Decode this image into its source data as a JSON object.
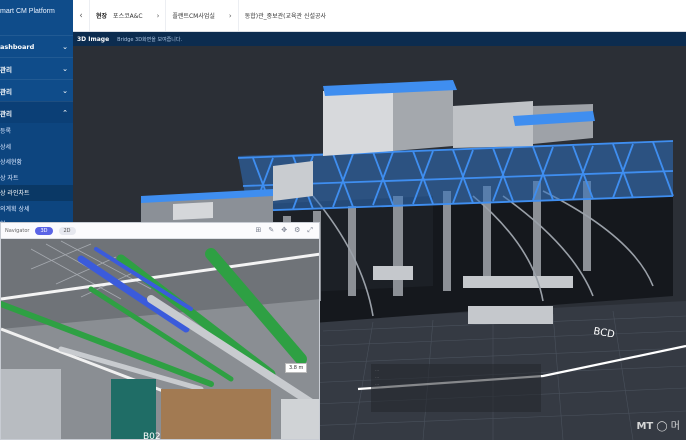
{
  "brand": "mart CM Platform",
  "sidebar": {
    "items": [
      {
        "label": "ashboard",
        "expanded": false
      },
      {
        "label": "관리",
        "expanded": false
      },
      {
        "label": "관리",
        "expanded": false
      },
      {
        "label": "관리",
        "expanded": true
      }
    ],
    "subitems": [
      "등록",
      "상세",
      "상세현황",
      "상 자트",
      "상 라인차트",
      "의계획 상세",
      "현"
    ],
    "active_subitem_index": 4
  },
  "breadcrumb": {
    "label": "현장",
    "items": [
      "포스코A&C",
      "플랜트CM사업실",
      "동합)관_중보관(교육관 신설공사"
    ]
  },
  "strip": {
    "title": "3D Image",
    "subtitle": "Bridge 3D화면을 보여줍니다."
  },
  "inset": {
    "tool_title": "Navigator",
    "mode_pills": [
      "3D",
      "2D"
    ],
    "label_tag": "3.8 m"
  },
  "viewport": {
    "info_lines": [
      "...",
      "...",
      "..."
    ]
  },
  "watermark": {
    "prefix": "MT",
    "suffix": "머"
  },
  "colors": {
    "sidebar": "#0f4c8a",
    "steel_blue": "#3a86e6",
    "pipe_green": "#2ea043",
    "pipe_blue": "#3b5bdb"
  }
}
